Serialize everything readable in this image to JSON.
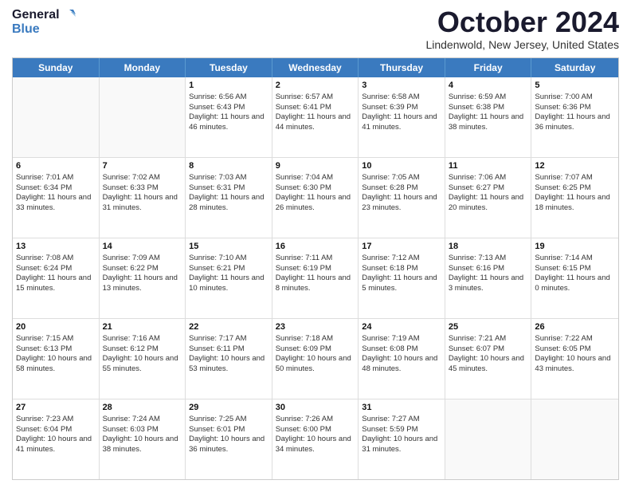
{
  "header": {
    "logo_line1": "General",
    "logo_line2": "Blue",
    "month_title": "October 2024",
    "location": "Lindenwold, New Jersey, United States"
  },
  "days_of_week": [
    "Sunday",
    "Monday",
    "Tuesday",
    "Wednesday",
    "Thursday",
    "Friday",
    "Saturday"
  ],
  "weeks": [
    [
      {
        "day": "",
        "sunrise": "",
        "sunset": "",
        "daylight": ""
      },
      {
        "day": "",
        "sunrise": "",
        "sunset": "",
        "daylight": ""
      },
      {
        "day": "1",
        "sunrise": "Sunrise: 6:56 AM",
        "sunset": "Sunset: 6:43 PM",
        "daylight": "Daylight: 11 hours and 46 minutes."
      },
      {
        "day": "2",
        "sunrise": "Sunrise: 6:57 AM",
        "sunset": "Sunset: 6:41 PM",
        "daylight": "Daylight: 11 hours and 44 minutes."
      },
      {
        "day": "3",
        "sunrise": "Sunrise: 6:58 AM",
        "sunset": "Sunset: 6:39 PM",
        "daylight": "Daylight: 11 hours and 41 minutes."
      },
      {
        "day": "4",
        "sunrise": "Sunrise: 6:59 AM",
        "sunset": "Sunset: 6:38 PM",
        "daylight": "Daylight: 11 hours and 38 minutes."
      },
      {
        "day": "5",
        "sunrise": "Sunrise: 7:00 AM",
        "sunset": "Sunset: 6:36 PM",
        "daylight": "Daylight: 11 hours and 36 minutes."
      }
    ],
    [
      {
        "day": "6",
        "sunrise": "Sunrise: 7:01 AM",
        "sunset": "Sunset: 6:34 PM",
        "daylight": "Daylight: 11 hours and 33 minutes."
      },
      {
        "day": "7",
        "sunrise": "Sunrise: 7:02 AM",
        "sunset": "Sunset: 6:33 PM",
        "daylight": "Daylight: 11 hours and 31 minutes."
      },
      {
        "day": "8",
        "sunrise": "Sunrise: 7:03 AM",
        "sunset": "Sunset: 6:31 PM",
        "daylight": "Daylight: 11 hours and 28 minutes."
      },
      {
        "day": "9",
        "sunrise": "Sunrise: 7:04 AM",
        "sunset": "Sunset: 6:30 PM",
        "daylight": "Daylight: 11 hours and 26 minutes."
      },
      {
        "day": "10",
        "sunrise": "Sunrise: 7:05 AM",
        "sunset": "Sunset: 6:28 PM",
        "daylight": "Daylight: 11 hours and 23 minutes."
      },
      {
        "day": "11",
        "sunrise": "Sunrise: 7:06 AM",
        "sunset": "Sunset: 6:27 PM",
        "daylight": "Daylight: 11 hours and 20 minutes."
      },
      {
        "day": "12",
        "sunrise": "Sunrise: 7:07 AM",
        "sunset": "Sunset: 6:25 PM",
        "daylight": "Daylight: 11 hours and 18 minutes."
      }
    ],
    [
      {
        "day": "13",
        "sunrise": "Sunrise: 7:08 AM",
        "sunset": "Sunset: 6:24 PM",
        "daylight": "Daylight: 11 hours and 15 minutes."
      },
      {
        "day": "14",
        "sunrise": "Sunrise: 7:09 AM",
        "sunset": "Sunset: 6:22 PM",
        "daylight": "Daylight: 11 hours and 13 minutes."
      },
      {
        "day": "15",
        "sunrise": "Sunrise: 7:10 AM",
        "sunset": "Sunset: 6:21 PM",
        "daylight": "Daylight: 11 hours and 10 minutes."
      },
      {
        "day": "16",
        "sunrise": "Sunrise: 7:11 AM",
        "sunset": "Sunset: 6:19 PM",
        "daylight": "Daylight: 11 hours and 8 minutes."
      },
      {
        "day": "17",
        "sunrise": "Sunrise: 7:12 AM",
        "sunset": "Sunset: 6:18 PM",
        "daylight": "Daylight: 11 hours and 5 minutes."
      },
      {
        "day": "18",
        "sunrise": "Sunrise: 7:13 AM",
        "sunset": "Sunset: 6:16 PM",
        "daylight": "Daylight: 11 hours and 3 minutes."
      },
      {
        "day": "19",
        "sunrise": "Sunrise: 7:14 AM",
        "sunset": "Sunset: 6:15 PM",
        "daylight": "Daylight: 11 hours and 0 minutes."
      }
    ],
    [
      {
        "day": "20",
        "sunrise": "Sunrise: 7:15 AM",
        "sunset": "Sunset: 6:13 PM",
        "daylight": "Daylight: 10 hours and 58 minutes."
      },
      {
        "day": "21",
        "sunrise": "Sunrise: 7:16 AM",
        "sunset": "Sunset: 6:12 PM",
        "daylight": "Daylight: 10 hours and 55 minutes."
      },
      {
        "day": "22",
        "sunrise": "Sunrise: 7:17 AM",
        "sunset": "Sunset: 6:11 PM",
        "daylight": "Daylight: 10 hours and 53 minutes."
      },
      {
        "day": "23",
        "sunrise": "Sunrise: 7:18 AM",
        "sunset": "Sunset: 6:09 PM",
        "daylight": "Daylight: 10 hours and 50 minutes."
      },
      {
        "day": "24",
        "sunrise": "Sunrise: 7:19 AM",
        "sunset": "Sunset: 6:08 PM",
        "daylight": "Daylight: 10 hours and 48 minutes."
      },
      {
        "day": "25",
        "sunrise": "Sunrise: 7:21 AM",
        "sunset": "Sunset: 6:07 PM",
        "daylight": "Daylight: 10 hours and 45 minutes."
      },
      {
        "day": "26",
        "sunrise": "Sunrise: 7:22 AM",
        "sunset": "Sunset: 6:05 PM",
        "daylight": "Daylight: 10 hours and 43 minutes."
      }
    ],
    [
      {
        "day": "27",
        "sunrise": "Sunrise: 7:23 AM",
        "sunset": "Sunset: 6:04 PM",
        "daylight": "Daylight: 10 hours and 41 minutes."
      },
      {
        "day": "28",
        "sunrise": "Sunrise: 7:24 AM",
        "sunset": "Sunset: 6:03 PM",
        "daylight": "Daylight: 10 hours and 38 minutes."
      },
      {
        "day": "29",
        "sunrise": "Sunrise: 7:25 AM",
        "sunset": "Sunset: 6:01 PM",
        "daylight": "Daylight: 10 hours and 36 minutes."
      },
      {
        "day": "30",
        "sunrise": "Sunrise: 7:26 AM",
        "sunset": "Sunset: 6:00 PM",
        "daylight": "Daylight: 10 hours and 34 minutes."
      },
      {
        "day": "31",
        "sunrise": "Sunrise: 7:27 AM",
        "sunset": "Sunset: 5:59 PM",
        "daylight": "Daylight: 10 hours and 31 minutes."
      },
      {
        "day": "",
        "sunrise": "",
        "sunset": "",
        "daylight": ""
      },
      {
        "day": "",
        "sunrise": "",
        "sunset": "",
        "daylight": ""
      }
    ]
  ]
}
